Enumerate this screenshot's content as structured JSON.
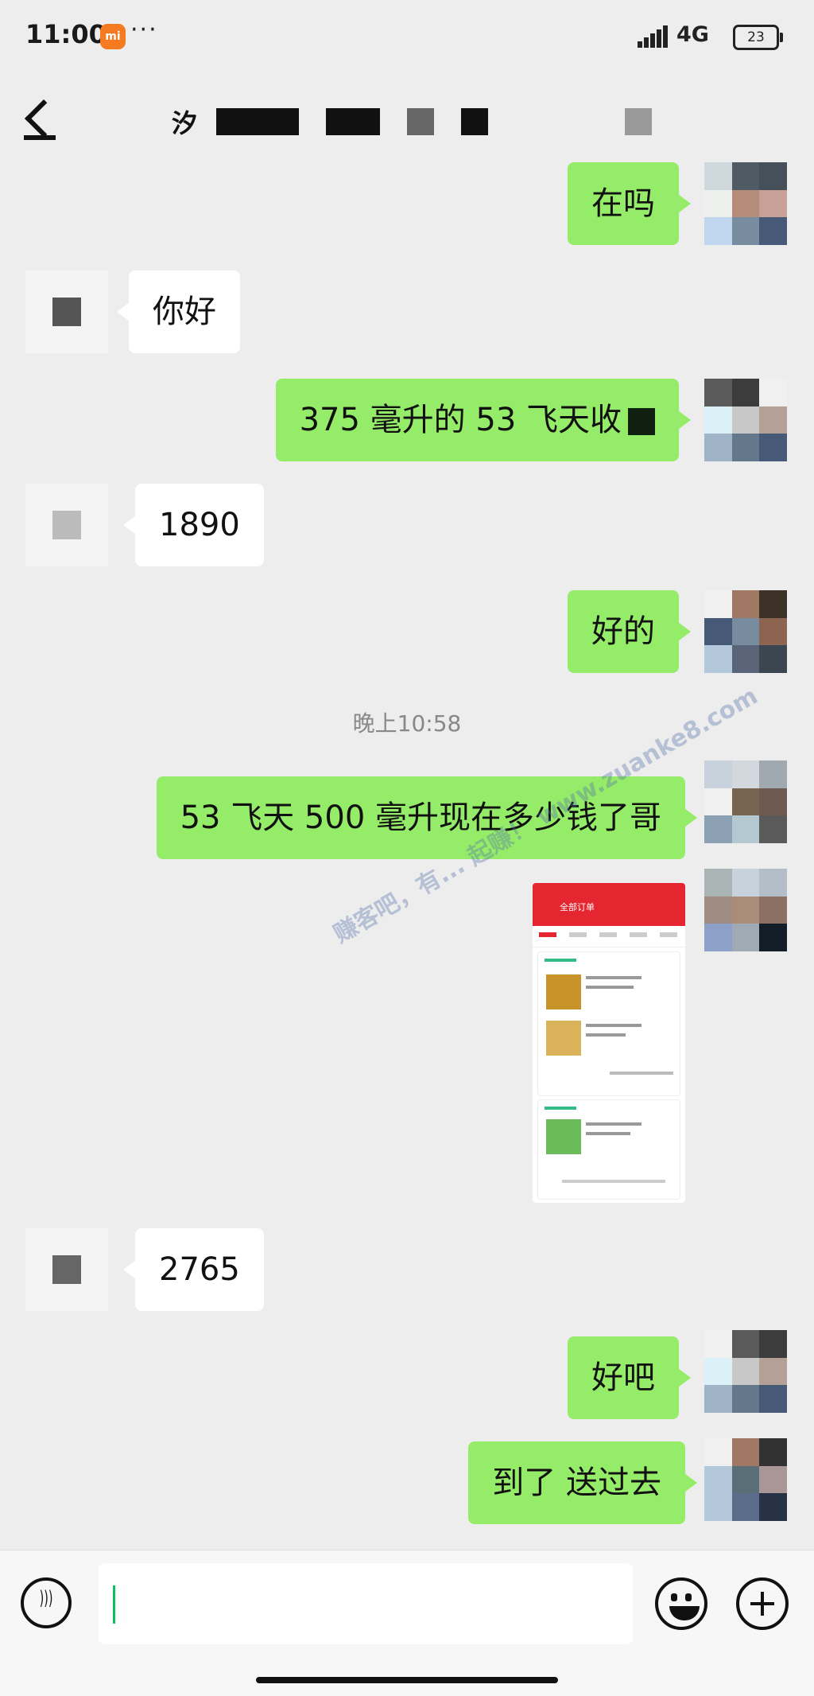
{
  "status_bar": {
    "time": "11:00",
    "app_badge": "mi",
    "more": "···",
    "network": "4G",
    "battery": "23"
  },
  "header": {
    "title_visible": "汐"
  },
  "messages": [
    {
      "side": "me",
      "text": "在吗"
    },
    {
      "side": "them",
      "text": "你好"
    },
    {
      "side": "me",
      "text": "375 毫升的 53 飞天收"
    },
    {
      "side": "them",
      "text": "1890"
    },
    {
      "side": "me",
      "text": "好的"
    },
    {
      "side": "me",
      "text": "53 飞天 500 毫升现在多少钱了哥"
    },
    {
      "side": "them",
      "text": "2765"
    },
    {
      "side": "me",
      "text": "好吧"
    },
    {
      "side": "me",
      "text": "到了 送过去"
    }
  ],
  "time_separator": "晚上10:58",
  "shared_image": {
    "header": "全部订单"
  },
  "watermark": "赚客吧，有... 起赚！ www.zuanke8.com",
  "colors": {
    "my_bubble": "#95ec69",
    "their_bubble": "#ffffff",
    "background": "#ededed",
    "caret": "#07c160"
  }
}
